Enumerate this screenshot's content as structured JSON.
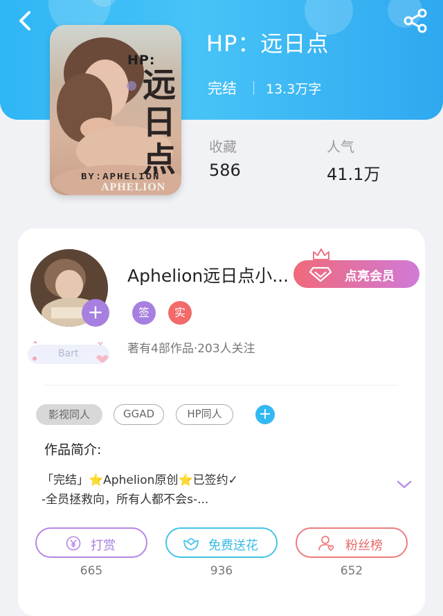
{
  "header": {
    "back_icon": "back-arrow-icon",
    "share_icon": "share-icon",
    "gradient": [
      "#2fb6f5",
      "#47c3f7"
    ]
  },
  "book": {
    "title": "HP：远日点",
    "cover": {
      "title_prefix": "HP:",
      "title": "远日点",
      "byline": "BY:APHELION",
      "signature": "APHELION"
    },
    "status": "完结",
    "word_count": "13.3万字",
    "stats": [
      {
        "label": "收藏",
        "value": "586"
      },
      {
        "label": "人气",
        "value": "41.1万"
      }
    ]
  },
  "author": {
    "name": "Aphelion远日点小...",
    "badge": "Bart",
    "tags": [
      {
        "label": "签",
        "color": "#a77fe0"
      },
      {
        "label": "实",
        "color": "#f26a6a"
      }
    ],
    "info": "著有4部作品·203人关注",
    "vip_button": "点亮会员",
    "vip_colors": [
      "#f0697a",
      "#d07ad8"
    ]
  },
  "tags": [
    "影视同人",
    "GGAD",
    "HP同人"
  ],
  "intro": {
    "label": "作品简介:",
    "line1": "「完结」⭐Aphelion原创⭐已签约✓",
    "line2": "-全员拯救向，所有人都不会s-..."
  },
  "actions": [
    {
      "label": "打赏",
      "count": "665",
      "icon": "yen-coin-icon",
      "color": "#b685e6"
    },
    {
      "label": "免费送花",
      "count": "936",
      "icon": "flower-icon",
      "color": "#45c2e8"
    },
    {
      "label": "粉丝榜",
      "count": "652",
      "icon": "fan-user-icon",
      "color": "#ee7b7b"
    }
  ]
}
